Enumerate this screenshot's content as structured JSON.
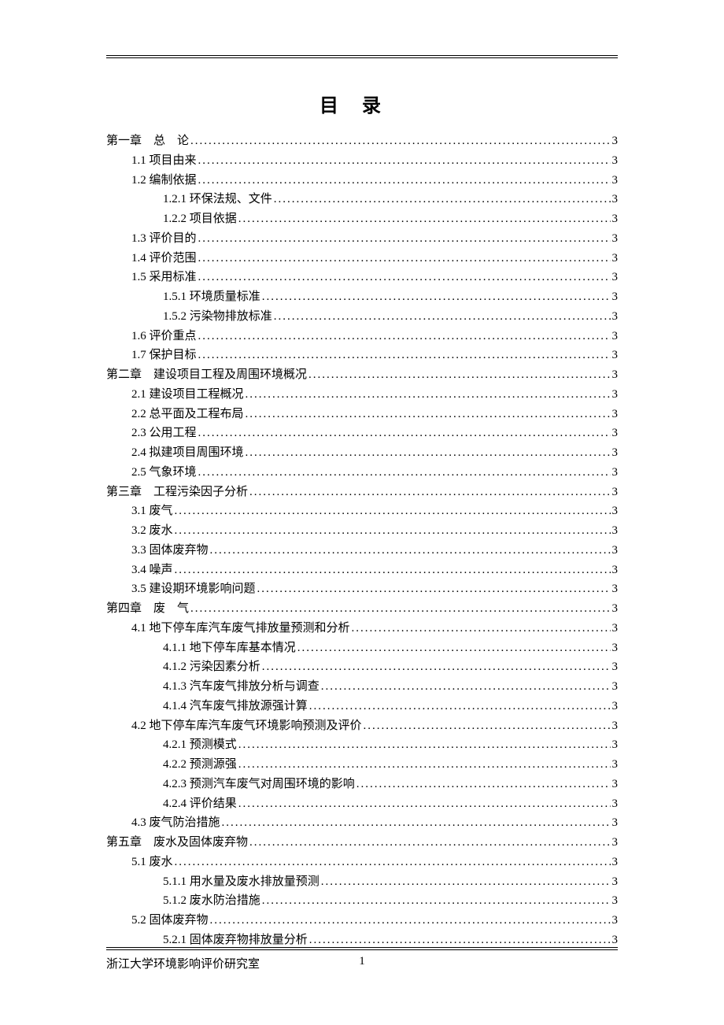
{
  "title": "目录",
  "footer": {
    "org": "浙江大学环境影响评价研究室",
    "page": "1"
  },
  "toc": [
    {
      "level": 0,
      "label": "第一章　总　论",
      "page": "3"
    },
    {
      "level": 1,
      "label": "1.1 项目由来",
      "page": "3"
    },
    {
      "level": 1,
      "label": "1.2 编制依据",
      "page": "3"
    },
    {
      "level": 2,
      "label": "1.2.1 环保法规、文件",
      "page": "3"
    },
    {
      "level": 2,
      "label": "1.2.2 项目依据",
      "page": "3"
    },
    {
      "level": 1,
      "label": "1.3 评价目的",
      "page": "3"
    },
    {
      "level": 1,
      "label": "1.4 评价范围",
      "page": "3"
    },
    {
      "level": 1,
      "label": "1.5 采用标准",
      "page": "3"
    },
    {
      "level": 2,
      "label": "1.5.1 环境质量标准",
      "page": "3"
    },
    {
      "level": 2,
      "label": "1.5.2 污染物排放标准",
      "page": "3"
    },
    {
      "level": 1,
      "label": "1.6 评价重点",
      "page": "3"
    },
    {
      "level": 1,
      "label": "1.7 保护目标",
      "page": "3"
    },
    {
      "level": 0,
      "label": "第二章　建设项目工程及周围环境概况",
      "page": "3"
    },
    {
      "level": 1,
      "label": "2.1 建设项目工程概况",
      "page": "3"
    },
    {
      "level": 1,
      "label": "2.2 总平面及工程布局",
      "page": "3"
    },
    {
      "level": 1,
      "label": "2.3 公用工程",
      "page": "3"
    },
    {
      "level": 1,
      "label": "2.4 拟建项目周围环境",
      "page": "3"
    },
    {
      "level": 1,
      "label": "2.5 气象环境",
      "page": "3"
    },
    {
      "level": 0,
      "label": "第三章　工程污染因子分析",
      "page": "3"
    },
    {
      "level": 1,
      "label": "3.1 废气",
      "page": "3"
    },
    {
      "level": 1,
      "label": "3.2 废水",
      "page": "3"
    },
    {
      "level": 1,
      "label": "3.3 固体废弃物",
      "page": "3"
    },
    {
      "level": 1,
      "label": "3.4 噪声",
      "page": "3"
    },
    {
      "level": 1,
      "label": "3.5 建设期环境影响问题",
      "page": "3"
    },
    {
      "level": 0,
      "label": "第四章　废　气",
      "page": "3"
    },
    {
      "level": 1,
      "label": "4.1 地下停车库汽车废气排放量预测和分析",
      "page": "3"
    },
    {
      "level": 2,
      "label": "4.1.1 地下停车库基本情况",
      "page": "3"
    },
    {
      "level": 2,
      "label": "4.1.2 污染因素分析",
      "page": "3"
    },
    {
      "level": 2,
      "label": "4.1.3 汽车废气排放分析与调查",
      "page": "3"
    },
    {
      "level": 2,
      "label": "4.1.4 汽车废气排放源强计算",
      "page": "3"
    },
    {
      "level": 1,
      "label": "4.2 地下停车库汽车废气环境影响预测及评价",
      "page": "3"
    },
    {
      "level": 2,
      "label": "4.2.1 预测模式",
      "page": "3"
    },
    {
      "level": 2,
      "label": "4.2.2 预测源强",
      "page": "3"
    },
    {
      "level": 2,
      "label": "4.2.3  预测汽车废气对周围环境的影响",
      "page": "3"
    },
    {
      "level": 2,
      "label": "4.2.4  评价结果",
      "page": "3"
    },
    {
      "level": 1,
      "label": "4.3 废气防治措施",
      "page": "3"
    },
    {
      "level": 0,
      "label": "第五章　废水及固体废弃物",
      "page": "3"
    },
    {
      "level": 1,
      "label": "5.1 废水",
      "page": "3"
    },
    {
      "level": 2,
      "label": "5.1.1 用水量及废水排放量预测",
      "page": "3"
    },
    {
      "level": 2,
      "label": "5.1.2  废水防治措施",
      "page": "3"
    },
    {
      "level": 1,
      "label": "5.2 固体废弃物",
      "page": "3"
    },
    {
      "level": 2,
      "label": "5.2.1 固体废弃物排放量分析",
      "page": "3"
    }
  ]
}
